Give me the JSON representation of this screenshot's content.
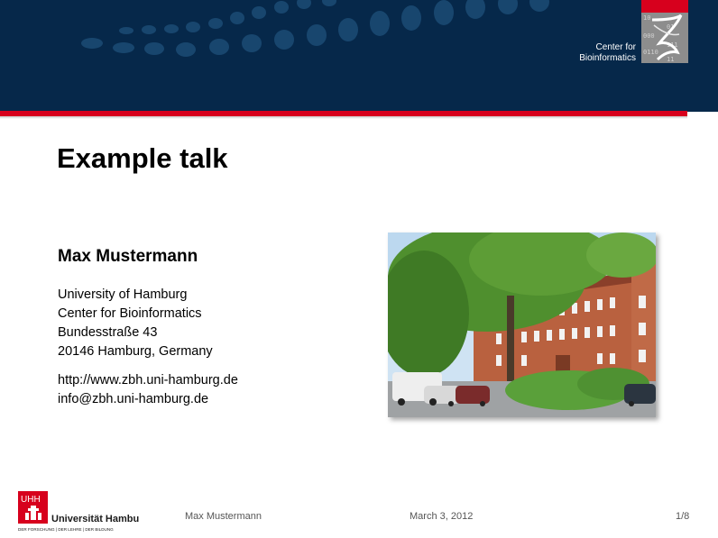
{
  "header": {
    "institute_line1": "Center for",
    "institute_line2": "Bioinformatics",
    "logo_digits": [
      "10",
      "01",
      "000",
      "111",
      "0110",
      "11"
    ]
  },
  "slide": {
    "title": "Example talk",
    "author": "Max Mustermann",
    "address": [
      "University of Hamburg",
      "Center for Bioinformatics",
      "Bundesstraße 43",
      "20146 Hamburg, Germany"
    ],
    "contact": [
      "http://www.zbh.uni-hamburg.de",
      "info@zbh.uni-hamburg.de"
    ]
  },
  "footer": {
    "university_logo": "UHH",
    "university_name": "Universität Hamburg",
    "university_tagline": "DER FORSCHUNG | DER LEHRE | DER BILDUNG",
    "author": "Max Mustermann",
    "date": "March 3, 2012",
    "page": "1/8"
  },
  "colors": {
    "header_blue": "#06284a",
    "accent_red": "#d7001d"
  }
}
